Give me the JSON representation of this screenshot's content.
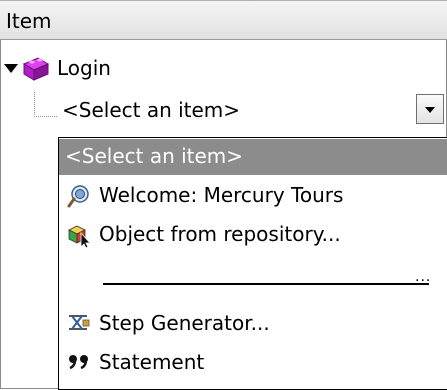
{
  "column_header": "Item",
  "tree": {
    "root_label": "Login",
    "combo_value": "<Select an item>"
  },
  "dropdown": {
    "items": [
      {
        "label": "<Select an item>",
        "icon": "none",
        "selected": true
      },
      {
        "label": "Welcome: Mercury Tours",
        "icon": "browser-page-icon"
      },
      {
        "label": "Object from repository...",
        "icon": "object-repository-icon"
      },
      {
        "label": "Step Generator...",
        "icon": "step-generator-icon"
      },
      {
        "label": "Statement",
        "icon": "statement-icon"
      }
    ],
    "separator_dots": "..."
  },
  "colors": {
    "selection": "#8c8c8c",
    "header": "#e8e8e8",
    "login_icon": "#b020c0"
  }
}
